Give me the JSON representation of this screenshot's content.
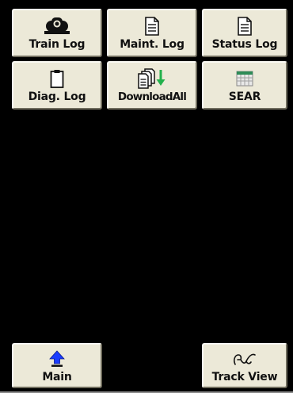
{
  "buttons": {
    "train_log": {
      "label": "Train Log",
      "icon": "locomotive-icon"
    },
    "maint_log": {
      "label": "Maint. Log",
      "icon": "document-icon"
    },
    "status_log": {
      "label": "Status Log",
      "icon": "document-icon"
    },
    "diag_log": {
      "label": "Diag. Log",
      "icon": "clipboard-icon"
    },
    "download_all": {
      "label": "DownloadAll",
      "icon": "documents-download-icon"
    },
    "sear": {
      "label": "SEAR",
      "icon": "spreadsheet-icon"
    },
    "main": {
      "label": "Main",
      "icon": "up-arrow-icon"
    },
    "track_view": {
      "label": "Track View",
      "icon": "track-glyph-icon"
    }
  },
  "colors": {
    "background": "#000000",
    "button_face": "#ece9d8",
    "arrow_blue": "#1a3cff",
    "download_green": "#22b14c",
    "sheet_green": "#2e8b57",
    "sheet_gray": "#c8c8c8"
  }
}
